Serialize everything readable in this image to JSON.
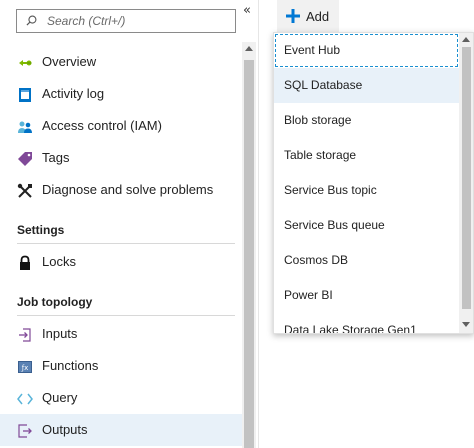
{
  "search": {
    "placeholder": "Search (Ctrl+/)",
    "value": ""
  },
  "collapse_glyph": "«",
  "nav": {
    "items": [
      {
        "label": "Overview",
        "icon": "overview-icon"
      },
      {
        "label": "Activity log",
        "icon": "activity-log-icon"
      },
      {
        "label": "Access control (IAM)",
        "icon": "access-control-icon"
      },
      {
        "label": "Tags",
        "icon": "tag-icon"
      },
      {
        "label": "Diagnose and solve problems",
        "icon": "wrench-icon"
      }
    ],
    "settings_heading": "Settings",
    "settings_items": [
      {
        "label": "Locks",
        "icon": "lock-icon"
      }
    ],
    "topology_heading": "Job topology",
    "topology_items": [
      {
        "label": "Inputs",
        "icon": "inputs-icon"
      },
      {
        "label": "Functions",
        "icon": "functions-icon"
      },
      {
        "label": "Query",
        "icon": "query-icon"
      },
      {
        "label": "Outputs",
        "icon": "outputs-icon",
        "selected": true
      }
    ]
  },
  "toolbar": {
    "add_label": "Add"
  },
  "dropdown": {
    "items": [
      {
        "label": "Event Hub",
        "focused": true
      },
      {
        "label": "SQL Database",
        "hover": true
      },
      {
        "label": "Blob storage"
      },
      {
        "label": "Table storage"
      },
      {
        "label": "Service Bus topic"
      },
      {
        "label": "Service Bus queue"
      },
      {
        "label": "Cosmos DB"
      },
      {
        "label": "Power BI"
      },
      {
        "label": "Data Lake Storage Gen1"
      }
    ]
  },
  "colors": {
    "accent": "#0078d4",
    "selected_bg": "#e8f1f9",
    "focus_outline": "#1a8fd0"
  }
}
